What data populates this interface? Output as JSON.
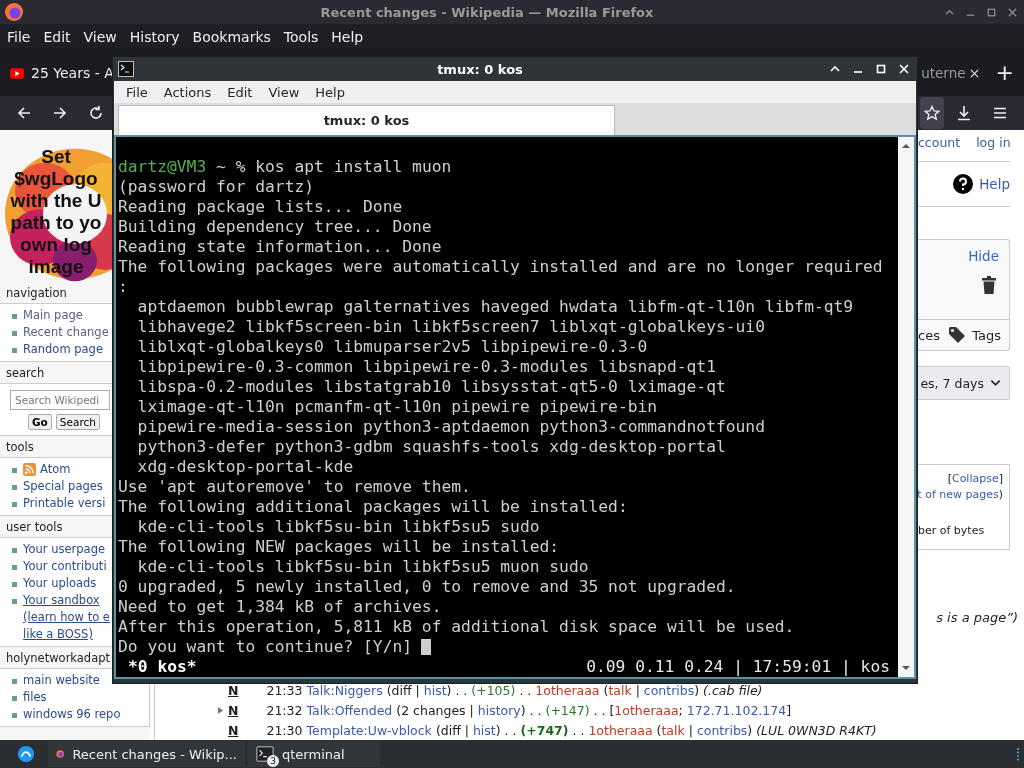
{
  "firefox": {
    "title": "Recent changes - Wikipedia — Mozilla Firefox",
    "menu": [
      "File",
      "Edit",
      "View",
      "History",
      "Bookmarks",
      "Tools",
      "Help"
    ],
    "tabs": [
      {
        "label": "25 Years - A",
        "kind": "video"
      },
      {
        "label": "uterne",
        "kind": "plain"
      }
    ],
    "new_tab": "+"
  },
  "sidebar": {
    "logo_lines": [
      "Set",
      "$wgLogo",
      "with the U",
      "path to yo",
      "own log",
      "image"
    ],
    "portlets": [
      {
        "kind": "links",
        "heading": "navigation",
        "items": [
          {
            "text": "Main page",
            "visited": true
          },
          {
            "text": "Recent change",
            "visited": true
          },
          {
            "text": "Random page",
            "visited": false
          }
        ]
      },
      {
        "kind": "search",
        "heading": "search",
        "placeholder": "Search Wikipedi",
        "buttons": [
          "Go",
          "Search"
        ]
      },
      {
        "kind": "links",
        "heading": "tools",
        "items": [
          {
            "text": "Atom",
            "kind": "feed"
          },
          {
            "text": "Special pages",
            "kind": "link"
          },
          {
            "text": "Printable versi",
            "kind": "link"
          }
        ]
      },
      {
        "kind": "links",
        "heading": "user tools",
        "items": [
          {
            "text": "Your userpage"
          },
          {
            "text": "Your contributi"
          },
          {
            "text": "Your uploads"
          },
          {
            "text": "Your sandbox",
            "note_lines": [
              "(learn how to e",
              "like a BOSS)"
            ]
          }
        ]
      },
      {
        "kind": "links",
        "heading": "holynetworkadapt",
        "items": [
          {
            "text": "main website"
          },
          {
            "text": "files"
          },
          {
            "text": "windows 96 repo"
          }
        ]
      }
    ]
  },
  "right": {
    "account": "ccount",
    "login": "log in",
    "help": "Help",
    "hide": "Hide",
    "sources": "ces",
    "tags": "Tags",
    "period": "es, 7 days",
    "legend": {
      "open": "[",
      "collapse": "Collapse",
      "close": "]",
      "new_pages": "t of new pages",
      "paren": ")",
      "bytes": "ber of bytes"
    },
    "note": "s is a page”)"
  },
  "changes": [
    {
      "expandable": false,
      "flag": "N",
      "time": "21:33",
      "title": "Talk:Niggers",
      "segments": [
        {
          "kind": "plain",
          "text": "(diff | "
        },
        {
          "kind": "link",
          "text": "hist"
        },
        {
          "kind": "plain",
          "text": ") . . "
        },
        {
          "kind": "size",
          "text": "(+105)"
        },
        {
          "kind": "plain",
          "text": " . . "
        },
        {
          "kind": "redlink",
          "text": "1otheraaa"
        },
        {
          "kind": "plain",
          "text": " ("
        },
        {
          "kind": "redlink",
          "text": "talk"
        },
        {
          "kind": "plain",
          "text": " | "
        },
        {
          "kind": "link",
          "text": "contribs"
        },
        {
          "kind": "plain",
          "text": ") "
        },
        {
          "kind": "comment",
          "text": "(.cab file)"
        }
      ]
    },
    {
      "expandable": true,
      "flag": "N",
      "time": "21:32",
      "title": "Talk:Offended",
      "segments": [
        {
          "kind": "plain",
          "text": "(2 changes | "
        },
        {
          "kind": "link",
          "text": "history"
        },
        {
          "kind": "plain",
          "text": ") . . "
        },
        {
          "kind": "size",
          "text": "(+147)"
        },
        {
          "kind": "plain",
          "text": " . . ["
        },
        {
          "kind": "redlink",
          "text": "1otheraaa"
        },
        {
          "kind": "plain",
          "text": "; "
        },
        {
          "kind": "link",
          "text": "172.71.102.174"
        },
        {
          "kind": "plain",
          "text": "]"
        }
      ]
    },
    {
      "expandable": false,
      "flag": "N",
      "time": "21:30",
      "title": "Template:Uw-vblock",
      "segments": [
        {
          "kind": "plain",
          "text": "(diff | "
        },
        {
          "kind": "link",
          "text": "hist"
        },
        {
          "kind": "plain",
          "text": ") . . "
        },
        {
          "kind": "size_bold",
          "text": "(+747)"
        },
        {
          "kind": "plain",
          "text": " . . "
        },
        {
          "kind": "redlink",
          "text": "1otheraaa"
        },
        {
          "kind": "plain",
          "text": " ("
        },
        {
          "kind": "redlink",
          "text": "talk"
        },
        {
          "kind": "plain",
          "text": " | "
        },
        {
          "kind": "link",
          "text": "contribs"
        },
        {
          "kind": "plain",
          "text": ") "
        },
        {
          "kind": "comment",
          "text": "(LUL 0WN3D R4KT)"
        }
      ]
    }
  ],
  "terminal": {
    "title": "tmux: 0 kos",
    "menu": [
      "File",
      "Actions",
      "Edit",
      "View",
      "Help"
    ],
    "tabs": [
      {
        "label": "tmux: 0 kos",
        "selected": true
      }
    ],
    "prompt": {
      "user": "dartz@VM3",
      "command": " ~ % kos apt install muon"
    },
    "output": [
      "(password for dartz)",
      "Reading package lists... Done",
      "Building dependency tree... Done",
      "Reading state information... Done",
      "The following packages were automatically installed and are no longer required",
      ":",
      "  aptdaemon bubblewrap galternatives haveged hwdata libfm-qt-l10n libfm-qt9",
      "  libhavege2 libkf5screen-bin libkf5screen7 liblxqt-globalkeys-ui0",
      "  liblxqt-globalkeys0 libmuparser2v5 libpipewire-0.3-0",
      "  libpipewire-0.3-common libpipewire-0.3-modules libsnapd-qt1",
      "  libspa-0.2-modules libstatgrab10 libsysstat-qt5-0 lximage-qt",
      "  lximage-qt-l10n pcmanfm-qt-l10n pipewire pipewire-bin",
      "  pipewire-media-session python3-aptdaemon python3-commandnotfound",
      "  python3-defer python3-gdbm squashfs-tools xdg-desktop-portal",
      "  xdg-desktop-portal-kde",
      "Use 'apt autoremove' to remove them.",
      "The following additional packages will be installed:",
      "  kde-cli-tools libkf5su-bin libkf5su5 sudo",
      "The following NEW packages will be installed:",
      "  kde-cli-tools libkf5su-bin libkf5su5 muon sudo",
      "0 upgraded, 5 newly installed, 0 to remove and 35 not upgraded.",
      "Need to get 1,384 kB of archives.",
      "After this operation, 5,811 kB of additional disk space will be used."
    ],
    "input": {
      "text": "Do you want to continue? [Y/n]",
      "cursor": true
    },
    "status": {
      "window": "*0 kos*",
      "info": "0.09 0.11 0.24 | 17:59:01 | kos"
    }
  },
  "taskbar": {
    "tasks": [
      {
        "label": "Recent changes - Wikip...",
        "kind": "browser"
      },
      {
        "label": "qterminal",
        "kind": "terminal",
        "badge": "3"
      }
    ]
  }
}
